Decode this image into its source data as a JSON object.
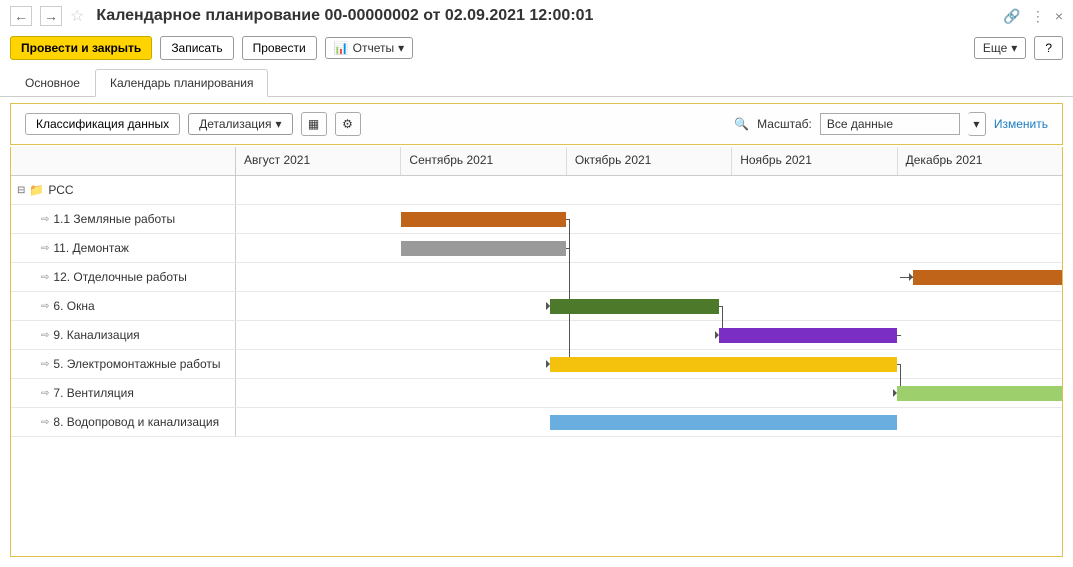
{
  "header": {
    "title": "Календарное планирование 00-00000002 от 02.09.2021 12:00:01"
  },
  "toolbar": {
    "save_close": "Провести и закрыть",
    "save": "Записать",
    "post": "Провести",
    "reports": "Отчеты",
    "more": "Еще",
    "help": "?"
  },
  "tabs": {
    "main": "Основное",
    "calendar": "Календарь планирования"
  },
  "sub_toolbar": {
    "classify": "Классификация данных",
    "detail": "Детализация",
    "scale_label": "Масштаб:",
    "scale_value": "Все данные",
    "edit": "Изменить"
  },
  "chart_data": {
    "type": "gantt",
    "time_axis": {
      "start": "2021-08-01",
      "end": "2021-12-31",
      "columns": [
        "Август 2021",
        "Сентябрь 2021",
        "Октябрь 2021",
        "Ноябрь 2021",
        "Декабрь 2021"
      ]
    },
    "root": {
      "label": "РСС"
    },
    "tasks": [
      {
        "id": "t1",
        "label": "1.1 Земляные работы",
        "start_pct": 20,
        "width_pct": 20,
        "color": "#c0641a"
      },
      {
        "id": "t2",
        "label": "11. Демонтаж",
        "start_pct": 20,
        "width_pct": 20,
        "color": "#9a9a9a"
      },
      {
        "id": "t3",
        "label": "12. Отделочные работы",
        "start_pct": 82,
        "width_pct": 18,
        "color": "#c0641a"
      },
      {
        "id": "t4",
        "label": "6. Окна",
        "start_pct": 38,
        "width_pct": 20.5,
        "color": "#4c7a2a"
      },
      {
        "id": "t5",
        "label": "9. Канализация",
        "start_pct": 58.5,
        "width_pct": 21.5,
        "color": "#7a2ec4"
      },
      {
        "id": "t6",
        "label": "5. Электромонтажные работы",
        "start_pct": 38,
        "width_pct": 42,
        "color": "#f4c20d"
      },
      {
        "id": "t7",
        "label": "7. Вентиляция",
        "start_pct": 80,
        "width_pct": 20,
        "color": "#9dd06c"
      },
      {
        "id": "t8",
        "label": "8. Водопровод и канализация",
        "start_pct": 38,
        "width_pct": 42,
        "color": "#6aaee0"
      }
    ],
    "dependencies": [
      {
        "from": "t1",
        "to": "t4"
      },
      {
        "from": "t2",
        "to": "t4"
      },
      {
        "from": "t4",
        "to": "t5"
      },
      {
        "from": "t5",
        "to": "t3"
      },
      {
        "from": "t1",
        "to": "t6"
      },
      {
        "from": "t6",
        "to": "t7"
      }
    ]
  }
}
